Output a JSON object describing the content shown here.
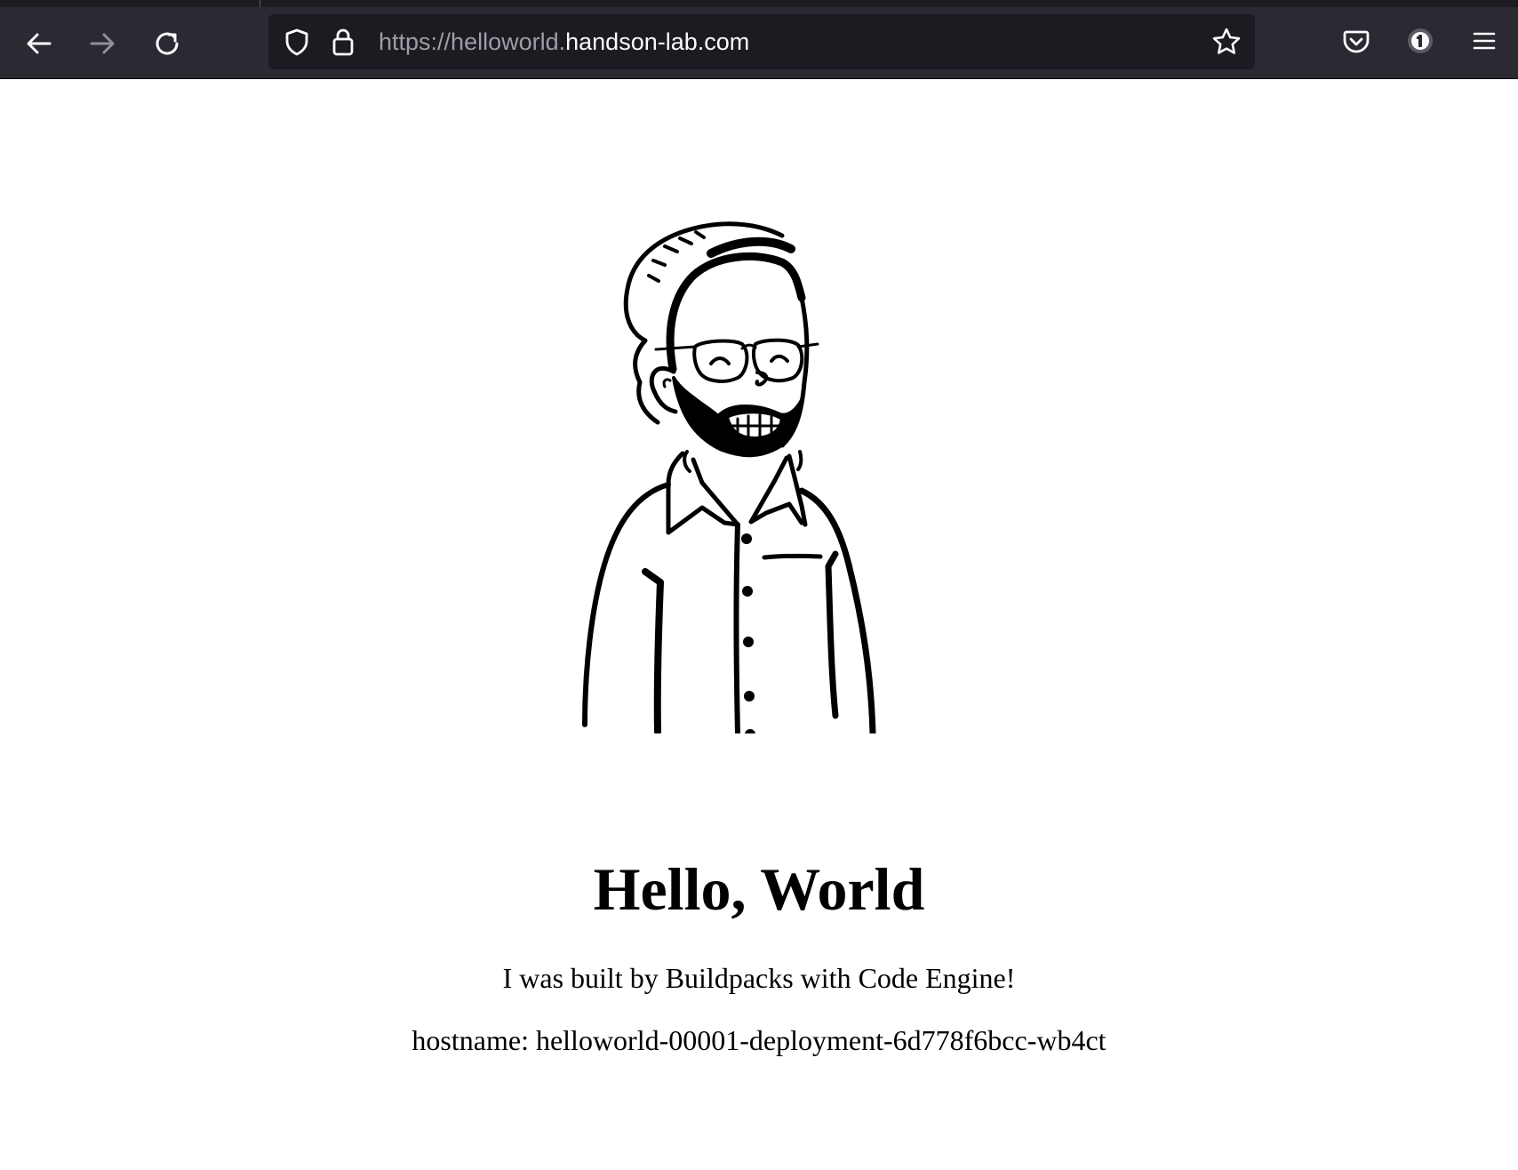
{
  "browser": {
    "url_scheme": "https://",
    "url_subdomain": "helloworld.",
    "url_host": "handson-lab.com",
    "icons": {
      "back": "back-arrow-icon",
      "forward": "forward-arrow-icon",
      "reload": "reload-icon",
      "tracking": "shield-icon",
      "lock": "lock-icon",
      "bookmark": "star-icon",
      "pocket": "pocket-icon",
      "extension": "password-manager-icon",
      "menu": "hamburger-menu-icon"
    },
    "colors": {
      "toolbar": "#2b2a33",
      "urlbar": "#1c1b22",
      "icon": "#fbfbfe",
      "icon_disabled": "#8f8f9d"
    }
  },
  "page": {
    "illustration": "person-with-beanie-glasses-beard-illustration",
    "title": "Hello, World",
    "subtitle": "I was built by Buildpacks with Code Engine!",
    "hostname": "hostname: helloworld-00001-deployment-6d778f6bcc-wb4ct"
  }
}
